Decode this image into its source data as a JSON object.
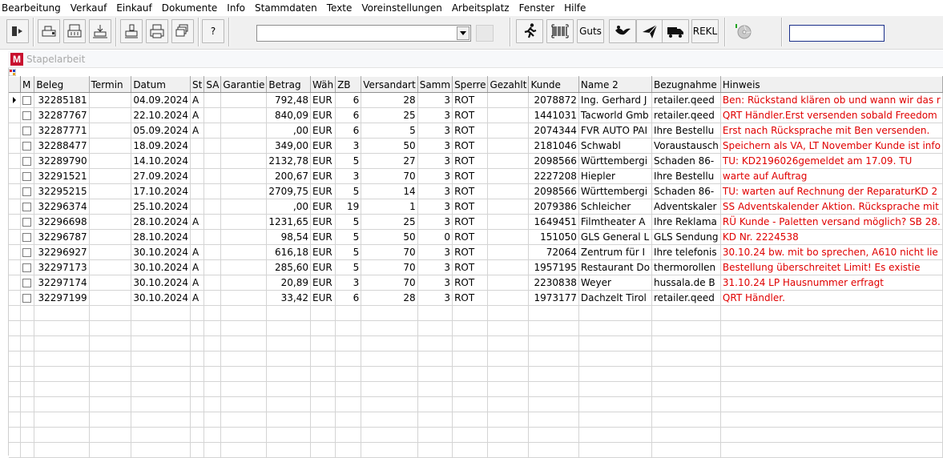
{
  "menu": [
    "Bearbeitung",
    "Verkauf",
    "Einkauf",
    "Dokumente",
    "Info",
    "Stammdaten",
    "Texte",
    "Voreinstellungen",
    "Arbeitsplatz",
    "Fenster",
    "Hilfe"
  ],
  "toolbar": {
    "help_label": "?",
    "guts_label": "Guts",
    "rekl_label": "REKL",
    "combo_value": "",
    "status_value": ""
  },
  "window": {
    "title": "Stapelarbeit",
    "logo": "M"
  },
  "columns": [
    "M",
    "Beleg",
    "Termin",
    "Datum",
    "St",
    "SA",
    "Garantie",
    "Betrag",
    "Wäh",
    "ZB",
    "Versandart",
    "Samm",
    "Sperre",
    "Gezahlt",
    "Kunde",
    "Name 2",
    "Bezugnahme",
    "Hinweis"
  ],
  "rows": [
    {
      "beleg": "32285181",
      "termin": "",
      "datum": "04.09.2024",
      "st": "A",
      "sa": "",
      "garantie": "",
      "betrag": "792,48",
      "waeh": "EUR",
      "zb": "6",
      "versandart": "28",
      "samm": "3",
      "sperre": "ROT",
      "gezahlt": "",
      "kunde": "2078872",
      "name2": "Ing. Gerhard J",
      "bezugnahme": "retailer.qeed",
      "hinweis": "Ben: Rückstand klären ob und wann wir das r"
    },
    {
      "beleg": "32287767",
      "termin": "",
      "datum": "22.10.2024",
      "st": "A",
      "sa": "",
      "garantie": "",
      "betrag": "840,09",
      "waeh": "EUR",
      "zb": "6",
      "versandart": "25",
      "samm": "3",
      "sperre": "ROT",
      "gezahlt": "",
      "kunde": "1441031",
      "name2": "Tacworld Gmb",
      "bezugnahme": "retailer.qeed",
      "hinweis": "QRT Händler.Erst versenden sobald Freedom"
    },
    {
      "beleg": "32287771",
      "termin": "",
      "datum": "05.09.2024",
      "st": "A",
      "sa": "",
      "garantie": "",
      "betrag": ",00",
      "waeh": "EUR",
      "zb": "6",
      "versandart": "5",
      "samm": "3",
      "sperre": "ROT",
      "gezahlt": "",
      "kunde": "2074344",
      "name2": "FVR AUTO PAI",
      "bezugnahme": "Ihre Bestellu",
      "hinweis": "Erst nach Rücksprache mit Ben versenden."
    },
    {
      "beleg": "32288477",
      "termin": "",
      "datum": "18.09.2024",
      "st": "",
      "sa": "",
      "garantie": "",
      "betrag": "349,00",
      "waeh": "EUR",
      "zb": "3",
      "versandart": "50",
      "samm": "3",
      "sperre": "ROT",
      "gezahlt": "",
      "kunde": "2181046",
      "name2": "Schwabl",
      "bezugnahme": "Voraustausch",
      "hinweis": "Speichern als VA, LT November Kunde ist info"
    },
    {
      "beleg": "32289790",
      "termin": "",
      "datum": "14.10.2024",
      "st": "",
      "sa": "",
      "garantie": "",
      "betrag": "2132,78",
      "waeh": "EUR",
      "zb": "5",
      "versandart": "27",
      "samm": "3",
      "sperre": "ROT",
      "gezahlt": "",
      "kunde": "2098566",
      "name2": "Württembergi",
      "bezugnahme": "Schaden 86-",
      "hinweis": "TU: KD2196026gemeldet am 17.09. TU"
    },
    {
      "beleg": "32291521",
      "termin": "",
      "datum": "27.09.2024",
      "st": "",
      "sa": "",
      "garantie": "",
      "betrag": "200,67",
      "waeh": "EUR",
      "zb": "3",
      "versandart": "70",
      "samm": "3",
      "sperre": "ROT",
      "gezahlt": "",
      "kunde": "2227208",
      "name2": "Hiepler",
      "bezugnahme": "Ihre Bestellu",
      "hinweis": "warte auf Auftrag"
    },
    {
      "beleg": "32295215",
      "termin": "",
      "datum": "17.10.2024",
      "st": "",
      "sa": "",
      "garantie": "",
      "betrag": "2709,75",
      "waeh": "EUR",
      "zb": "5",
      "versandart": "14",
      "samm": "3",
      "sperre": "ROT",
      "gezahlt": "",
      "kunde": "2098566",
      "name2": "Württembergi",
      "bezugnahme": "Schaden 86-",
      "hinweis": "TU: warten auf Rechnung der ReparaturKD 2"
    },
    {
      "beleg": "32296374",
      "termin": "",
      "datum": "25.10.2024",
      "st": "",
      "sa": "",
      "garantie": "",
      "betrag": ",00",
      "waeh": "EUR",
      "zb": "19",
      "versandart": "1",
      "samm": "3",
      "sperre": "ROT",
      "gezahlt": "",
      "kunde": "2079386",
      "name2": "Schleicher",
      "bezugnahme": "Adventskaler",
      "hinweis": "SS Adventskalender Aktion. Rücksprache mit"
    },
    {
      "beleg": "32296698",
      "termin": "",
      "datum": "28.10.2024",
      "st": "A",
      "sa": "",
      "garantie": "",
      "betrag": "1231,65",
      "waeh": "EUR",
      "zb": "5",
      "versandart": "25",
      "samm": "3",
      "sperre": "ROT",
      "gezahlt": "",
      "kunde": "1649451",
      "name2": "Filmtheater A",
      "bezugnahme": "Ihre Reklama",
      "hinweis": "RÜ Kunde - Paletten versand möglich? SB 28."
    },
    {
      "beleg": "32296787",
      "termin": "",
      "datum": "28.10.2024",
      "st": "",
      "sa": "",
      "garantie": "",
      "betrag": "98,54",
      "waeh": "EUR",
      "zb": "5",
      "versandart": "50",
      "samm": "0",
      "sperre": "ROT",
      "gezahlt": "",
      "kunde": "151050",
      "name2": "GLS General L",
      "bezugnahme": "GLS Sendung",
      "hinweis": "KD Nr. 2224538"
    },
    {
      "beleg": "32296927",
      "termin": "",
      "datum": "30.10.2024",
      "st": "A",
      "sa": "",
      "garantie": "",
      "betrag": "616,18",
      "waeh": "EUR",
      "zb": "5",
      "versandart": "70",
      "samm": "3",
      "sperre": "ROT",
      "gezahlt": "",
      "kunde": "72064",
      "name2": "Zentrum für I",
      "bezugnahme": "Ihre telefonis",
      "hinweis": "30.10.24 bw. mit bo sprechen, A610 nicht lie"
    },
    {
      "beleg": "32297173",
      "termin": "",
      "datum": "30.10.2024",
      "st": "A",
      "sa": "",
      "garantie": "",
      "betrag": "285,60",
      "waeh": "EUR",
      "zb": "5",
      "versandart": "70",
      "samm": "3",
      "sperre": "ROT",
      "gezahlt": "",
      "kunde": "1957195",
      "name2": "Restaurant Do",
      "bezugnahme": "thermorollen",
      "hinweis": "Bestellung überschreitet Limit!       Es existie"
    },
    {
      "beleg": "32297174",
      "termin": "",
      "datum": "30.10.2024",
      "st": "A",
      "sa": "",
      "garantie": "",
      "betrag": "20,89",
      "waeh": "EUR",
      "zb": "3",
      "versandart": "70",
      "samm": "3",
      "sperre": "ROT",
      "gezahlt": "",
      "kunde": "2230838",
      "name2": "Weyer",
      "bezugnahme": "hussala.de B",
      "hinweis": "31.10.24 LP Hausnummer erfragt"
    },
    {
      "beleg": "32297199",
      "termin": "",
      "datum": "30.10.2024",
      "st": "A",
      "sa": "",
      "garantie": "",
      "betrag": "33,42",
      "waeh": "EUR",
      "zb": "6",
      "versandart": "28",
      "samm": "3",
      "sperre": "ROT",
      "gezahlt": "",
      "kunde": "1973177",
      "name2": "Dachzelt Tirol",
      "bezugnahme": "retailer.qeed",
      "hinweis": "QRT Händler."
    }
  ],
  "colors": {
    "note_text": "#e00000",
    "logo_bg": "#c8102e",
    "status_border": "#1a2f8a"
  },
  "icons": [
    "exit-icon",
    "cashregister-icon",
    "printer-icon",
    "export-icon",
    "stamp-icon",
    "print-icon",
    "stack-icon",
    "runner-icon",
    "barcode-icon",
    "bird-icon",
    "paperplane-icon",
    "truck-icon",
    "cd-icon"
  ]
}
